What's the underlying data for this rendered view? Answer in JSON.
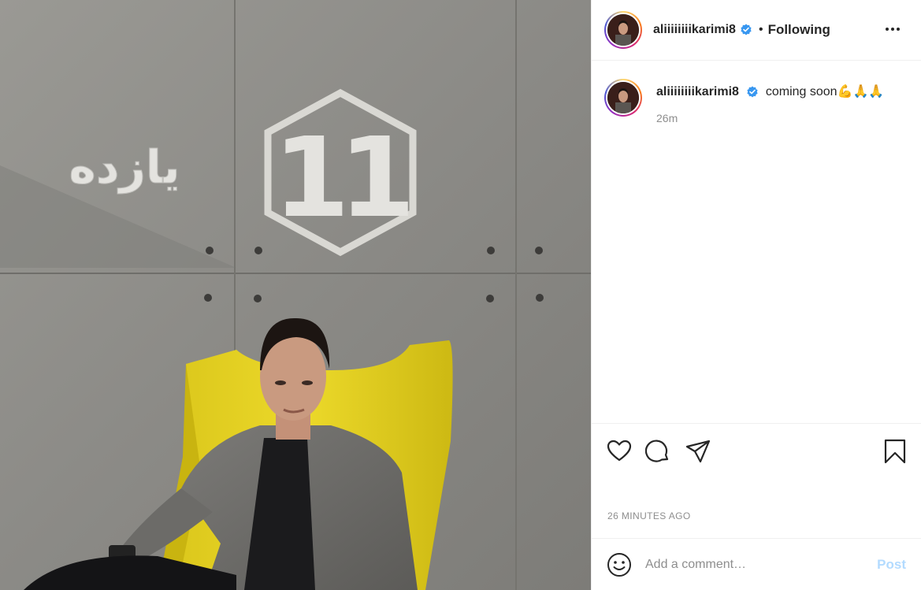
{
  "post": {
    "author": "aliiiiiiiikarimi8",
    "follow_status": "Following",
    "separator": "•",
    "caption": "coming soon💪🙏🙏",
    "caption_age": "26m",
    "timestamp": "26 MINUTES AGO",
    "photo_sign_text": "یازده",
    "photo_logo_number": "11"
  },
  "comment": {
    "placeholder": "Add a comment…",
    "post_label": "Post"
  },
  "icons": {
    "verified": "verified-badge-icon",
    "more": "more-options-icon",
    "like": "heart-icon",
    "comment": "comment-bubble-icon",
    "share": "paper-plane-icon",
    "save": "bookmark-icon",
    "emoji": "smiley-icon"
  },
  "colors": {
    "verified": "#3897f0",
    "post_button_disabled": "#b3dbff",
    "chair": "#e6d21e",
    "wall": "#8a8985"
  }
}
